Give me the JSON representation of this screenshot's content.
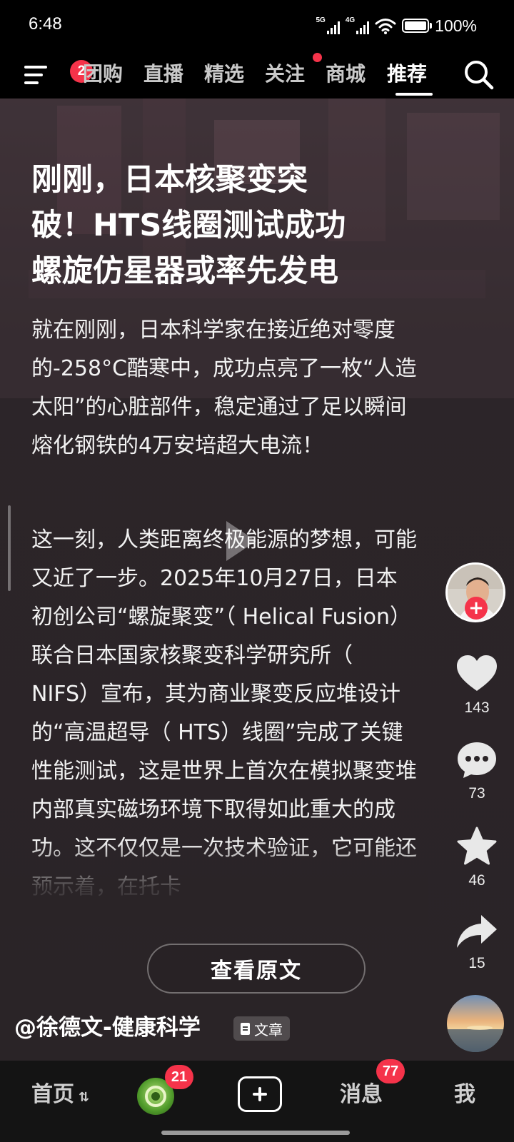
{
  "status_bar": {
    "time": "6:48",
    "network1": "5G",
    "network2": "4G",
    "battery": "100%"
  },
  "top_nav": {
    "menu_badge": "2",
    "tabs": [
      {
        "label": "团购"
      },
      {
        "label": "直播"
      },
      {
        "label": "精选"
      },
      {
        "label": "关注"
      },
      {
        "label": "商城"
      },
      {
        "label": "推荐"
      }
    ],
    "active_tab": "推荐",
    "icons": {
      "menu": "hamburger-menu-icon",
      "search": "search-icon"
    }
  },
  "article": {
    "title_lines": [
      "刚刚，日本核聚变突",
      "破！HTS线圈测试成功",
      "螺旋仿星器或率先发电"
    ],
    "paragraph1": "就在刚刚，日本科学家在接近绝对零度的-258°C酷寒中，成功点亮了一枚“人造太阳”的心脏部件，稳定通过了足以瞬间熔化钢铁的4万安培超大电流！",
    "paragraph2": "这一刻，人类距离终极能源的梦想，可能又近了一步。2025年10月27日，日本初创公司“螺旋聚变”（ Helical Fusion）联合日本国家核聚变科学研究所（ NIFS）宣布，其为商业聚变反应堆设计的“高温超导（ HTS）线圈”完成了关键性能测试，这是世界上首次在模拟聚变堆内部真实磁场环境下取得如此重大的成功。这不仅仅是一次技术验证，它可能还预示着，在托卡",
    "view_original": "查看原文",
    "author": "@徐德文-健康科学",
    "type_tag": "文章"
  },
  "side_actions": {
    "likes": "143",
    "comments": "73",
    "favorites": "46",
    "shares": "15"
  },
  "bottom_nav": {
    "home": "首页",
    "friends_badge": "21",
    "messages": "消息",
    "messages_badge": "77",
    "me": "我"
  },
  "colors": {
    "accent_red": "#f5334a",
    "background": "#2a2427",
    "bottom_bar": "#141414"
  }
}
